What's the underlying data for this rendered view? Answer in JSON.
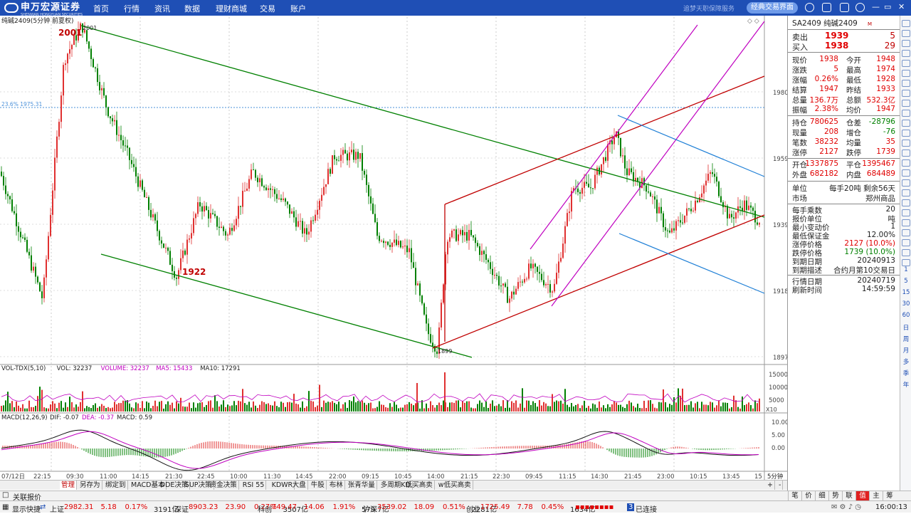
{
  "app": {
    "logo_text": "申万宏源证券",
    "logo_sub": "SHENWAN HONGYUAN SECURITIES",
    "slogan": "追梦天职保障服务",
    "classic_button": "经典交易界面",
    "nav": [
      "首页",
      "行情",
      "资讯",
      "数据",
      "理财商城",
      "交易",
      "账户"
    ]
  },
  "chart": {
    "title": "纯碱2409(5分钟 前夏权)",
    "price_ticks": [
      "1980",
      "1959",
      "1939",
      "1918",
      "1897"
    ],
    "fib_label": "23.6% 1975.31",
    "annotations": {
      "high": "2001",
      "high_small": "2001",
      "low_a": "1922",
      "low_b": "1899"
    },
    "vol_legend": {
      "name": "VOL-TDX(5,10)",
      "vol": "VOL: 32237",
      "volume": "VOLUME: 32237",
      "ma5": "MA5: 15433",
      "ma10": "MA10: 17291"
    },
    "vol_ticks": [
      "15000",
      "10000",
      "5000"
    ],
    "vol_unit": "X10",
    "macd_legend": {
      "name": "MACD(12,26,9)",
      "dif": "DIF: -0.07",
      "dea": "DEA: -0.37",
      "macd": "MACD: 0.59"
    },
    "macd_ticks": [
      "10.00",
      "5.00",
      "0.00"
    ],
    "time_ticks": [
      "07/12日",
      "22:15",
      "09:30",
      "11:00",
      "14:15",
      "21:30",
      "22:45",
      "10:00",
      "11:30",
      "14:45",
      "22:00",
      "09:15",
      "10:45",
      "14:00",
      "21:15",
      "22:30",
      "09:45",
      "11:15",
      "14:30",
      "21:45",
      "23:00",
      "10:15",
      "13:45",
      "15"
    ],
    "period": "5分钟"
  },
  "side": {
    "header": "SA2409 纯碱2409",
    "badge": "M",
    "sell": {
      "label": "卖出",
      "price": "1939",
      "qty": "5"
    },
    "buy": {
      "label": "买入",
      "price": "1938",
      "qty": "29"
    },
    "rows1": [
      [
        "现价",
        "1938",
        "今开",
        "1948"
      ],
      [
        "涨跌",
        "5",
        "最高",
        "1974"
      ],
      [
        "涨幅",
        "0.26%",
        "最低",
        "1928"
      ],
      [
        "结算",
        "1947",
        "昨结",
        "1933"
      ],
      [
        "总量",
        "136.7万",
        "总额",
        "532.3亿"
      ],
      [
        "振幅",
        "2.38%",
        "均价",
        "1947"
      ]
    ],
    "rows2": [
      [
        "持仓",
        "780625",
        "仓差",
        "-28796"
      ],
      [
        "现量",
        "208",
        "增仓",
        "-76"
      ],
      [
        "笔数",
        "38232",
        "均量",
        "35"
      ],
      [
        "涨停",
        "2127",
        "跌停",
        "1739"
      ]
    ],
    "rows3": [
      [
        "开仓",
        "1337875",
        "平仓",
        "1395467"
      ],
      [
        "外盘",
        "682182",
        "内盘",
        "684489"
      ]
    ],
    "rows4": [
      [
        "单位",
        "每手20吨",
        "剩余56天",
        ""
      ],
      [
        "市场",
        "",
        "郑州商品",
        ""
      ]
    ],
    "rows5": [
      [
        "每手乘数",
        "20"
      ],
      [
        "报价单位",
        "吨"
      ],
      [
        "最小变动价",
        "1"
      ],
      [
        "最低保证金",
        "12.00%"
      ],
      [
        "涨停价格",
        "2127 (10.0%)"
      ],
      [
        "跌停价格",
        "1739 (10.0%)"
      ],
      [
        "到期日期",
        "20240913"
      ],
      [
        "到期描述",
        "合约月第10交易日"
      ]
    ],
    "rows6": [
      [
        "行情日期",
        "20240719"
      ],
      [
        "刷新时间",
        "14:59:59"
      ]
    ]
  },
  "rtools": [
    "1",
    "5",
    "15",
    "30",
    "60",
    "日",
    "周",
    "月",
    "多",
    "季",
    "年"
  ],
  "tabs": [
    "管理",
    "另存为",
    "绑定到",
    "MACD基本",
    "DDE决策",
    "SUP决策",
    "资金决策",
    "RSI 55",
    "KDWR",
    "大盘",
    "牛股",
    "布林",
    "张青华量",
    "多周期KD",
    "低买高卖",
    "w低买高卖"
  ],
  "bottom1": {
    "left": "关联报价",
    "right_tabs": [
      "笔",
      "价",
      "细",
      "势",
      "联",
      "值",
      "主",
      "筹"
    ]
  },
  "bottom2": {
    "quick": "显示快捷",
    "sh": {
      "name": "上证",
      "v": "2982.31",
      "c": "5.18",
      "p": "0.17%",
      "a": "3191亿"
    },
    "sz": {
      "name": "深证",
      "v": "8903.23",
      "c": "23.90",
      "p": "0.27%",
      "a": "3507亿"
    },
    "kc": {
      "name": "科创",
      "v": "749.47",
      "c": "14.06",
      "p": "1.91%",
      "a": "579.7亿"
    },
    "hs": {
      "name": "沪深",
      "v": "3539.02",
      "c": "18.09",
      "p": "0.51%",
      "a": "2281亿"
    },
    "cy": {
      "name": "创业",
      "v": "1725.49",
      "c": "7.78",
      "p": "0.45%",
      "a": "1634亿"
    },
    "conn_num": "3",
    "conn": "已连接",
    "time": "16:00:13"
  }
}
